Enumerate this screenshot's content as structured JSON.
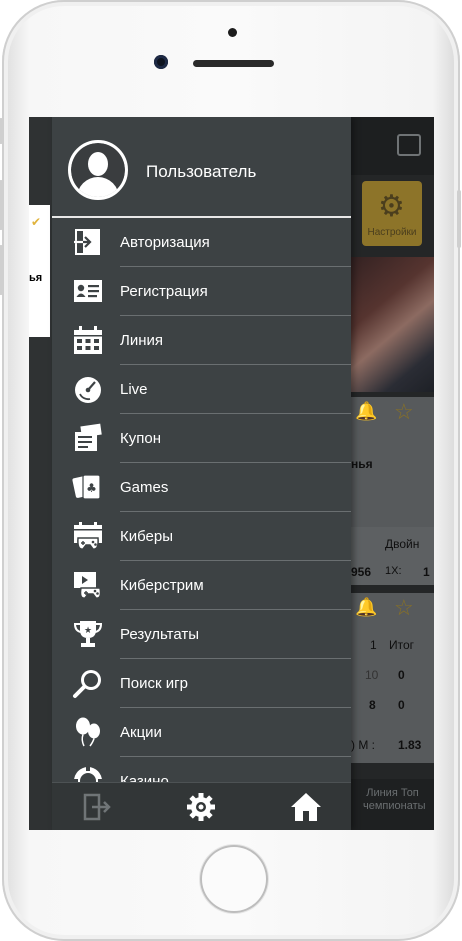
{
  "drawer": {
    "user_name": "Пользователь",
    "menu": [
      {
        "label": "Авторизация",
        "icon": "login-icon"
      },
      {
        "label": "Регистрация",
        "icon": "id-card-icon"
      },
      {
        "label": "Линия",
        "icon": "calendar-icon"
      },
      {
        "label": "Live",
        "icon": "stopwatch-icon"
      },
      {
        "label": "Купон",
        "icon": "ticket-icon"
      },
      {
        "label": "Games",
        "icon": "playing-cards-icon"
      },
      {
        "label": "Киберы",
        "icon": "cyber-calendar-icon"
      },
      {
        "label": "Киберстрим",
        "icon": "stream-gamepad-icon"
      },
      {
        "label": "Результаты",
        "icon": "trophy-icon"
      },
      {
        "label": "Поиск игр",
        "icon": "magnifier-icon"
      },
      {
        "label": "Акции",
        "icon": "balloons-icon"
      },
      {
        "label": "Казино",
        "icon": "casino-chip-icon"
      }
    ],
    "bottom": [
      {
        "icon": "logout-icon"
      },
      {
        "icon": "settings-gear-icon"
      },
      {
        "icon": "home-icon"
      }
    ]
  },
  "background_app": {
    "settings_label": "Настройки",
    "left_fragment": "ья",
    "text_fragment_1": "нья",
    "text_fragment_2": "Двойн",
    "odds_1": "956",
    "odds_label": "1X:",
    "odds_2": "1",
    "score_header_1": "1",
    "score_header_2": "Итог",
    "score_row_1a": "10",
    "score_row_1b": "0",
    "score_row_2a": "8",
    "score_row_2b": "0",
    "bottom_left": ") М :",
    "bottom_value": "1.83",
    "footer_text": "Линия Топ чемпионаты"
  }
}
